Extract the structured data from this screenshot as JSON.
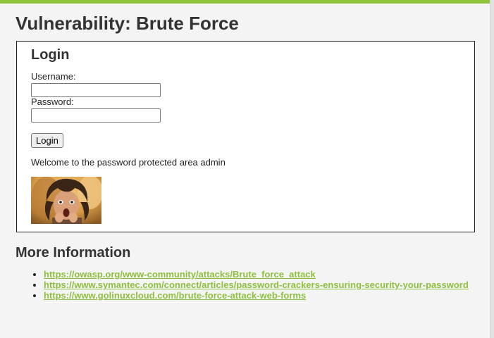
{
  "page": {
    "title": "Vulnerability: Brute Force",
    "accent_color": "#8fc43a"
  },
  "login": {
    "heading": "Login",
    "username_label": "Username:",
    "username_value": "",
    "password_label": "Password:",
    "password_value": "",
    "button_label": "Login",
    "welcome_message": "Welcome to the password protected area admin",
    "avatar_icon": "surprised-user-photo"
  },
  "more_info": {
    "heading": "More Information",
    "links": [
      "https://owasp.org/www-community/attacks/Brute_force_attack",
      "https://www.symantec.com/connect/articles/password-crackers-ensuring-security-your-password",
      "https://www.golinuxcloud.com/brute-force-attack-web-forms"
    ],
    "link_color": "#8ebf3f"
  }
}
